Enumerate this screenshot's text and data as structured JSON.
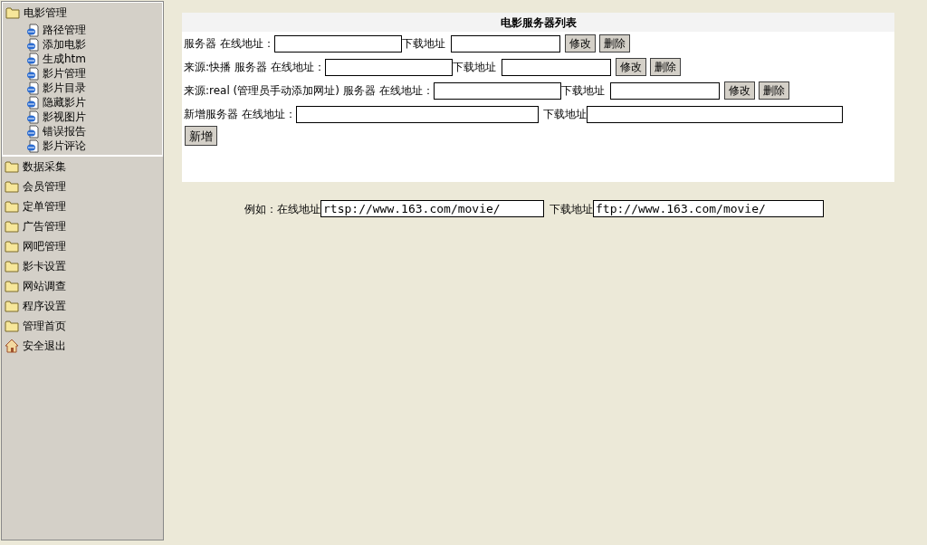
{
  "sidebar": {
    "items": [
      {
        "label": "电影管理",
        "kind": "folder",
        "expanded": true,
        "children": [
          {
            "label": "路径管理"
          },
          {
            "label": "添加电影"
          },
          {
            "label": "生成htm"
          },
          {
            "label": "影片管理"
          },
          {
            "label": "影片目录"
          },
          {
            "label": "隐藏影片"
          },
          {
            "label": "影视图片"
          },
          {
            "label": "错误报告"
          },
          {
            "label": "影片评论"
          }
        ]
      },
      {
        "label": "数据采集",
        "kind": "folder",
        "expanded": false
      },
      {
        "label": "会员管理",
        "kind": "folder",
        "expanded": false
      },
      {
        "label": "定单管理",
        "kind": "folder",
        "expanded": false
      },
      {
        "label": "广告管理",
        "kind": "folder",
        "expanded": false
      },
      {
        "label": "网吧管理",
        "kind": "folder",
        "expanded": false
      },
      {
        "label": "影卡设置",
        "kind": "folder",
        "expanded": false
      },
      {
        "label": "网站调查",
        "kind": "folder",
        "expanded": false
      },
      {
        "label": "程序设置",
        "kind": "folder",
        "expanded": false
      },
      {
        "label": "管理首页",
        "kind": "folder",
        "expanded": false
      },
      {
        "label": "安全退出",
        "kind": "home"
      }
    ]
  },
  "panel": {
    "title": "电影服务器列表",
    "rows": [
      {
        "label": "服务器 在线地址：",
        "download_label": "下载地址",
        "buttons": [
          "修改",
          "删除"
        ]
      },
      {
        "label": "来源:快播 服务器 在线地址：",
        "download_label": "下载地址",
        "buttons": [
          "修改",
          "删除"
        ]
      },
      {
        "label": "来源:real (管理员手动添加网址) 服务器 在线地址：",
        "download_label": "下载地址",
        "buttons": [
          "修改",
          "删除"
        ]
      }
    ],
    "new_row": {
      "label": "新增服务器 在线地址：",
      "download_label": "下载地址",
      "button": "新增"
    }
  },
  "example": {
    "label": "例如：在线地址",
    "online_value": "rtsp://www.163.com/movie/",
    "download_label": "下载地址",
    "download_value": "ftp://www.163.com/movie/"
  }
}
